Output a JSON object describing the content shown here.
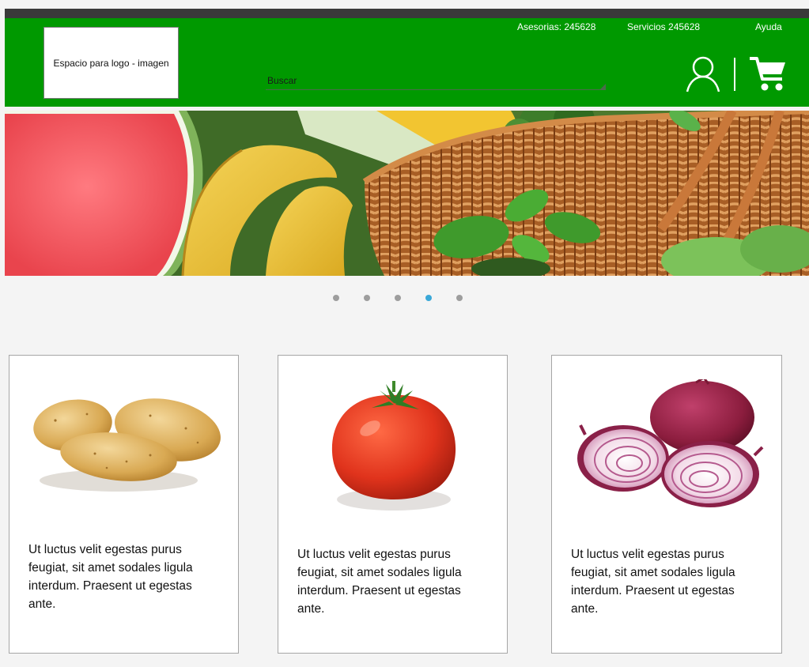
{
  "header": {
    "logo_placeholder": "Espacio para logo - imagen",
    "links": {
      "advisory": "Asesorias: 245628",
      "services": "Servicios 245628",
      "help": "Ayuda"
    },
    "search": {
      "placeholder": "Buscar"
    },
    "icons": {
      "account": "user-icon",
      "cart": "cart-icon"
    },
    "colors": {
      "brand_green": "#009900",
      "top_bar": "#3a3a3a"
    }
  },
  "carousel": {
    "slide_count": 5,
    "active_slide": 4,
    "colors": {
      "dot": "#9d9d9d",
      "active_dot": "#3aa8d8"
    }
  },
  "products": [
    {
      "name": "potatoes",
      "description": "Ut luctus velit egestas purus feugiat, sit amet sodales ligula interdum. Praesent ut egestas ante."
    },
    {
      "name": "tomato",
      "description": "Ut luctus velit egestas purus feugiat, sit amet sodales ligula interdum. Praesent ut egestas ante."
    },
    {
      "name": "red-onion",
      "description": "Ut luctus velit egestas purus feugiat, sit amet sodales ligula interdum. Praesent ut egestas ante."
    }
  ]
}
